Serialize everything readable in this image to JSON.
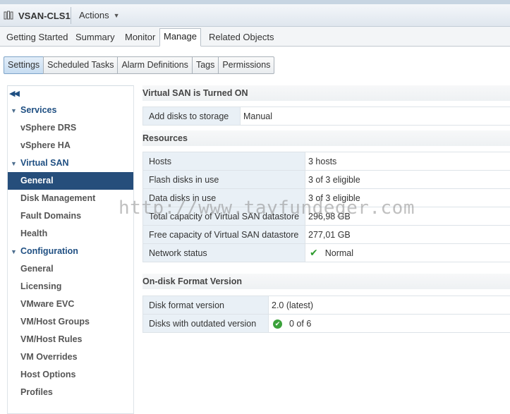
{
  "header": {
    "object_title": "VSAN-CLS1",
    "object_icon": "cluster-icon",
    "actions_label": "Actions"
  },
  "tabs": [
    {
      "label": "Getting Started"
    },
    {
      "label": "Summary"
    },
    {
      "label": "Monitor"
    },
    {
      "label": "Manage",
      "active": true
    },
    {
      "label": "Related Objects"
    }
  ],
  "subtabs": [
    {
      "label": "Settings",
      "active": true
    },
    {
      "label": "Scheduled Tasks"
    },
    {
      "label": "Alarm Definitions"
    },
    {
      "label": "Tags"
    },
    {
      "label": "Permissions"
    }
  ],
  "nav": {
    "collapse_icon": "double-chevron-left-icon",
    "items": [
      {
        "label": "Services",
        "type": "category"
      },
      {
        "label": "vSphere DRS",
        "type": "item"
      },
      {
        "label": "vSphere HA",
        "type": "item"
      },
      {
        "label": "Virtual SAN",
        "type": "category"
      },
      {
        "label": "General",
        "type": "item",
        "selected": true
      },
      {
        "label": "Disk Management",
        "type": "item"
      },
      {
        "label": "Fault Domains",
        "type": "item"
      },
      {
        "label": "Health",
        "type": "item"
      },
      {
        "label": "Configuration",
        "type": "category"
      },
      {
        "label": "General",
        "type": "item"
      },
      {
        "label": "Licensing",
        "type": "item"
      },
      {
        "label": "VMware EVC",
        "type": "item"
      },
      {
        "label": "VM/Host Groups",
        "type": "item"
      },
      {
        "label": "VM/Host Rules",
        "type": "item"
      },
      {
        "label": "VM Overrides",
        "type": "item"
      },
      {
        "label": "Host Options",
        "type": "item"
      },
      {
        "label": "Profiles",
        "type": "item"
      }
    ]
  },
  "vsan": {
    "status_heading": "Virtual SAN is Turned ON",
    "add_disks": {
      "label": "Add disks to storage",
      "value": "Manual"
    }
  },
  "resources": {
    "heading": "Resources",
    "rows": [
      {
        "label": "Hosts",
        "value": "3 hosts"
      },
      {
        "label": "Flash disks in use",
        "value": "3 of 3 eligible"
      },
      {
        "label": "Data disks in use",
        "value": "3 of 3 eligible"
      },
      {
        "label": "Total capacity of Virtual SAN datastore",
        "value": "296,98 GB"
      },
      {
        "label": "Free capacity of Virtual SAN datastore",
        "value": "277,01 GB"
      },
      {
        "label": "Network status",
        "value": "Normal",
        "icon": "check-icon"
      }
    ]
  },
  "ondisk": {
    "heading": "On-disk Format Version",
    "rows": [
      {
        "label": "Disk format version",
        "value": "2.0 (latest)"
      },
      {
        "label": "Disks with outdated version",
        "value": "0 of 6",
        "icon": "ok-status-icon"
      }
    ]
  },
  "watermark": "http://www.tayfundeger.com",
  "colors": {
    "selected_nav": "#264e7b",
    "category_text": "#1f4f82",
    "status_green": "#2e9b2e"
  }
}
